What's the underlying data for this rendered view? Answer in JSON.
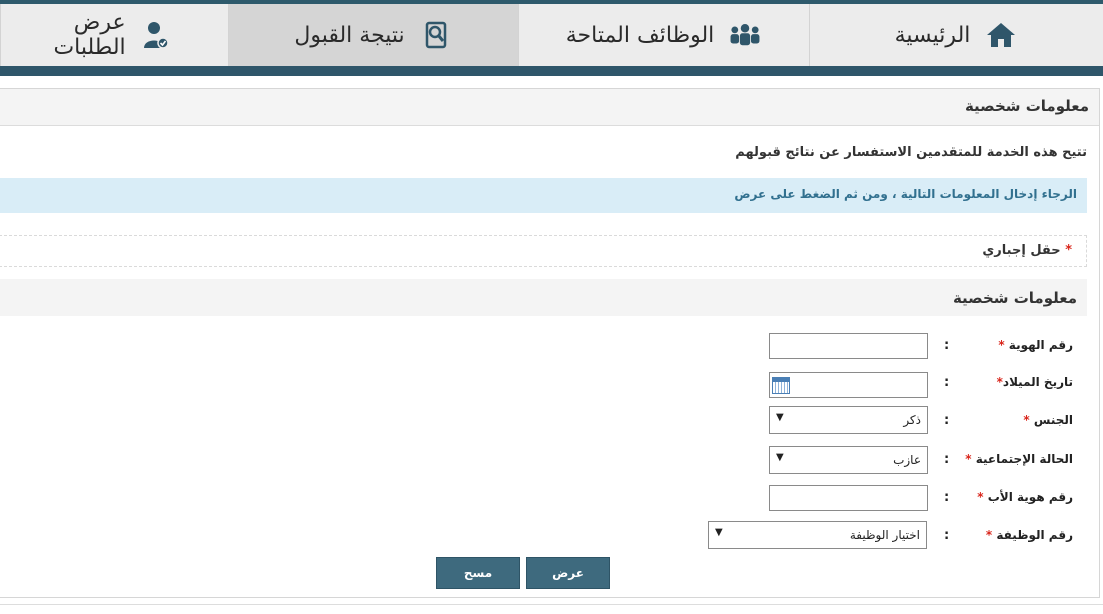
{
  "nav": {
    "home": "الرئيسية",
    "jobs": "الوظائف المتاحة",
    "result": "نتيجة القبول",
    "requests": "عرض الطلبات"
  },
  "panel": {
    "title": "معلومات شخصية",
    "description": "تتيح هذه الخدمة للمتقدمين الاستفسار عن نتائج قبولهم",
    "info": "الرجاء إدخال المعلومات التالية ، ومن ثم الضغط على عرض",
    "required_note": "حقل إجباري",
    "required_mark": "*"
  },
  "section": {
    "title": "معلومات شخصية"
  },
  "form": {
    "colon": ":",
    "id_label": "رقم الهوية",
    "birth_label": "تاريخ الميلاد",
    "gender_label": "الجنس",
    "gender_value": "ذكر",
    "marital_label": "الحالة الإجتماعية",
    "marital_value": "عازب",
    "father_id_label": "رقم هوية الأب",
    "job_label": "رقم الوظيفة",
    "job_value": "اختيار الوظيفة"
  },
  "actions": {
    "view": "عرض",
    "clear": "مسح"
  },
  "colors": {
    "primary": "#3e6a7e",
    "band": "#2f566a",
    "info_bg": "#d9edf7",
    "info_text": "#31708f",
    "required": "#d9261c"
  }
}
